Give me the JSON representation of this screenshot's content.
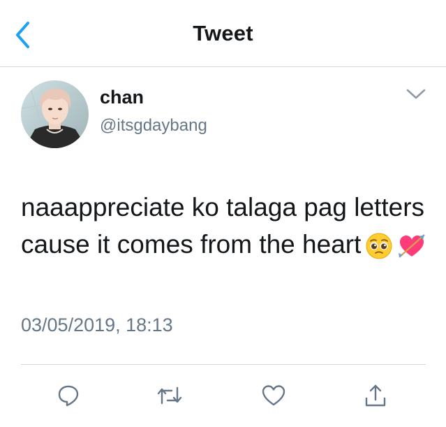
{
  "header": {
    "back_icon": "chevron-left-icon",
    "title": "Tweet"
  },
  "tweet": {
    "author": {
      "display_name": "chan",
      "handle": "@itsgdaybang"
    },
    "text": "naaappreciate ko talaga pag letters cause it comes from the heart",
    "emojis": [
      "pleading-face",
      "heart-with-arrow"
    ],
    "timestamp": "03/05/2019, 18:13"
  },
  "actions": [
    {
      "name": "reply",
      "icon": "reply-icon"
    },
    {
      "name": "retweet",
      "icon": "retweet-icon"
    },
    {
      "name": "like",
      "icon": "heart-icon"
    },
    {
      "name": "share",
      "icon": "share-icon"
    }
  ],
  "colors": {
    "accent": "#1da1f2",
    "text": "#14171a",
    "muted": "#657786",
    "divider": "#d6d6d6"
  }
}
